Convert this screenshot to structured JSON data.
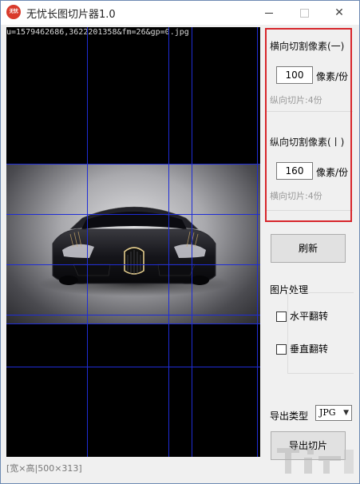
{
  "window": {
    "title": "无忧长图切片器1.0",
    "icon_text": "无忧"
  },
  "preview": {
    "filename": "u=1579462686,3622201358&fm=26&gp=0.jpg"
  },
  "horizontal": {
    "title": "横向切割像素(一)",
    "value": "100",
    "unit": "像素/份",
    "info": "纵向切片:4份"
  },
  "vertical": {
    "title": "纵向切割像素(丨)",
    "value": "160",
    "unit": "像素/份",
    "info": "横向切片:4份"
  },
  "buttons": {
    "refresh": "刷新",
    "export": "导出切片"
  },
  "image_processing": {
    "label": "图片处理",
    "flip_horizontal": "水平翻转",
    "flip_vertical": "垂直翻转",
    "flip_horizontal_checked": false,
    "flip_vertical_checked": false
  },
  "export": {
    "type_label": "导出类型",
    "type_value": "JPG"
  },
  "status": {
    "text": "[宽×高|500×313]"
  },
  "colors": {
    "accent_red": "#d7262b",
    "grid_blue": "#1f2dd6"
  }
}
